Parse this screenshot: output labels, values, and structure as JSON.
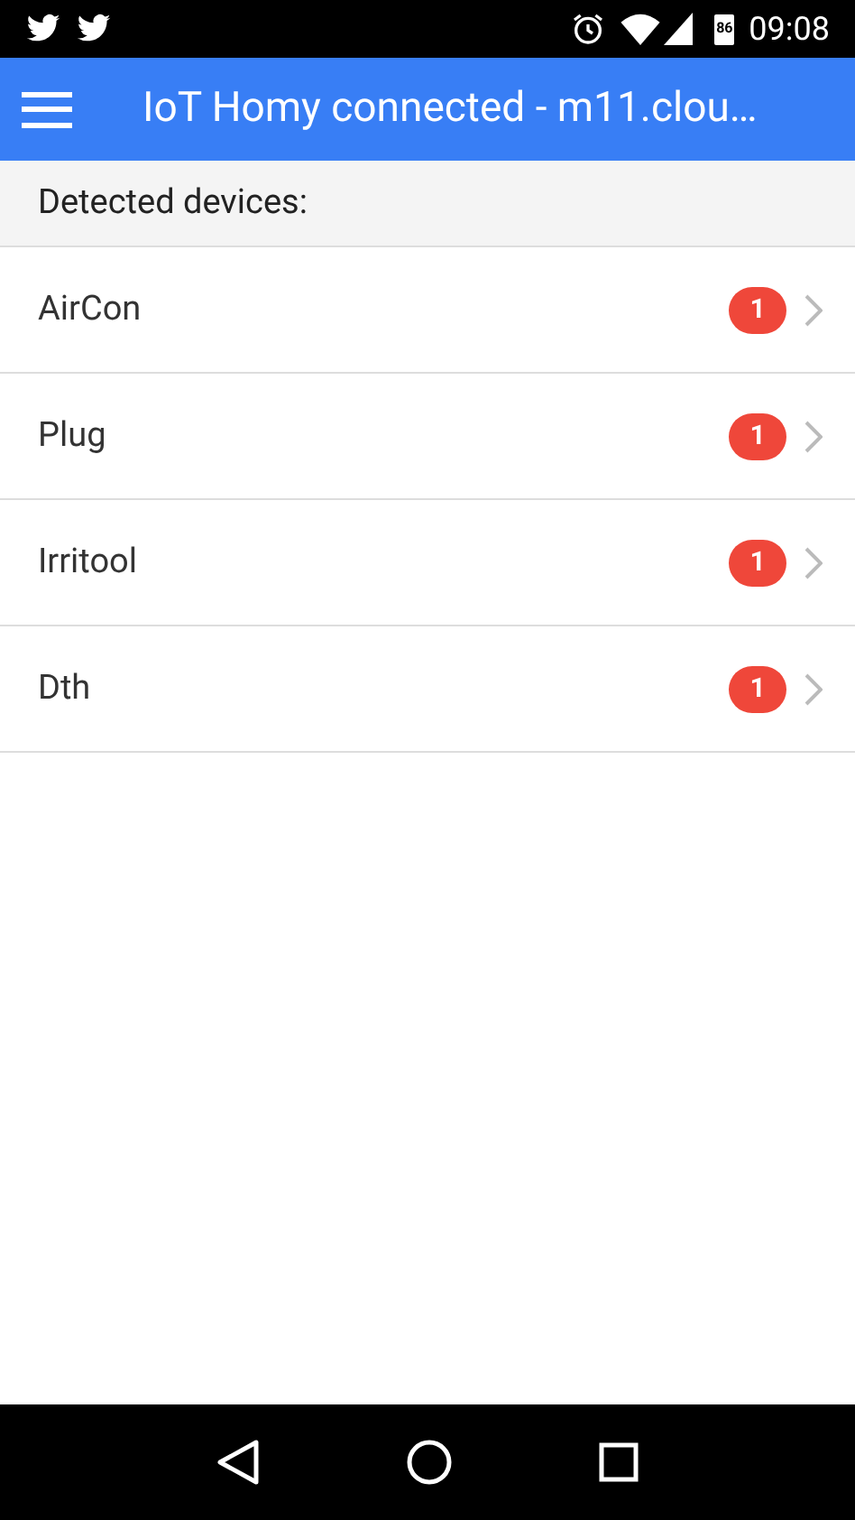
{
  "status_bar": {
    "battery": "86",
    "time": "09:08"
  },
  "header": {
    "title": "IoT Homy connected - m11.clou…"
  },
  "list_header": "Detected devices:",
  "devices": [
    {
      "name": "AirCon",
      "badge": "1"
    },
    {
      "name": "Plug",
      "badge": "1"
    },
    {
      "name": "Irritool",
      "badge": "1"
    },
    {
      "name": "Dth",
      "badge": "1"
    }
  ]
}
